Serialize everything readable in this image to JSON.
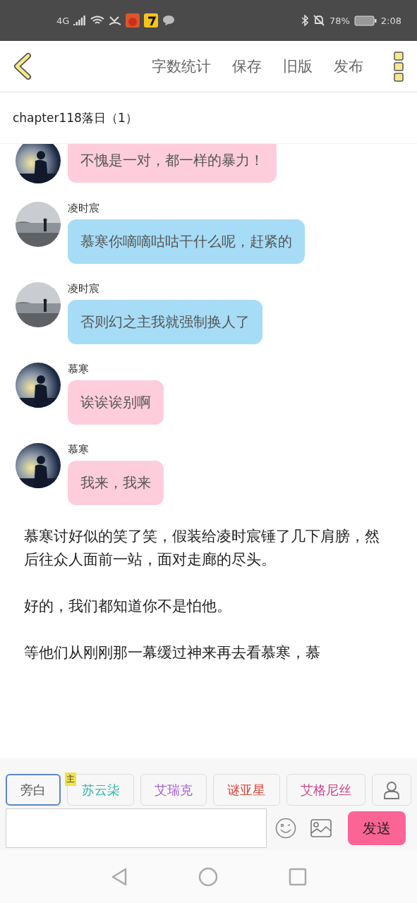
{
  "status_bar": {
    "network": "4G",
    "battery": "78%",
    "time": "2:08"
  },
  "toolbar": {
    "actions": [
      "字数统计",
      "保存",
      "旧版",
      "发布"
    ]
  },
  "chapter_title": "chapter118落日（1）",
  "messages": [
    {
      "kind": "dusk",
      "color": "#fdcddb",
      "text": "不愧是一对，都一样的暴力！"
    },
    {
      "name": "凌时宸",
      "kind": "sea",
      "color": "#a6dcf6",
      "text": "慕寒你嘀嘀咕咕干什么呢，赶紧的"
    },
    {
      "name": "凌时宸",
      "kind": "sea",
      "color": "#a6dcf6",
      "text": "否则幻之主我就强制换人了"
    },
    {
      "name": "慕寒",
      "kind": "dusk",
      "color": "#fdcddb",
      "text": "诶诶诶别啊"
    },
    {
      "name": "慕寒",
      "kind": "dusk",
      "color": "#fdcddb",
      "text": "我来，我来"
    }
  ],
  "paragraphs": [
    "慕寒讨好似的笑了笑，假装给凌时宸锤了几下肩膀，然后往众人面前一站，面对走廊的尽头。",
    "好的，我们都知道你不是怕他。",
    "等他们从刚刚那一幕缓过神来再去看慕寒，慕"
  ],
  "characters": [
    {
      "label": "旁白",
      "selected": true,
      "color": "#555555"
    },
    {
      "label": "苏云柒",
      "selected": false,
      "color": "#2fb5a8",
      "badge": "主"
    },
    {
      "label": "艾瑞克",
      "selected": false,
      "color": "#a45ecf"
    },
    {
      "label": "谜亚星",
      "selected": false,
      "color": "#d9453b"
    },
    {
      "label": "艾格尼丝",
      "selected": false,
      "color": "#d0428a"
    }
  ],
  "send_button": "发送"
}
